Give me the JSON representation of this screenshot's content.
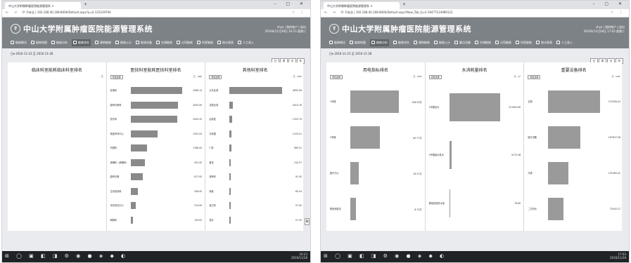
{
  "screens": [
    {
      "tab_title": "中山大学附属肿瘤医院能源管理系 ×",
      "url": "不安全 | 192.168.40.168:8000/Default.aspx?p=0.125239794",
      "app_title": "中山大学附属肿瘤医院能源管理系统",
      "user_line1": "zhyz | 我的帐户 | 退出",
      "user_line2": "2016年11月28日 16:23 星期二",
      "menu": [
        "能耗概况",
        "能耗地图",
        "能耗分析",
        "能耗排名",
        "建筑能耗",
        "能耗公示",
        "能效设备",
        "空调能耗",
        "分项能耗",
        "科室能耗",
        "统计报表",
        "人工录入"
      ],
      "active_menu": 3,
      "date_range": "日▾ 2016-11-23 至 2016-11-28",
      "periods": [
        "日",
        "周",
        "月",
        "年"
      ],
      "panels": [
        {
          "title": "临床科室能耗临床科室排名",
          "col_left": "",
          "col_right": "元",
          "rows": []
        },
        {
          "title": "医技科室能耗医技科室排名",
          "col_left": "项目选择",
          "col_right": "元 · kWh",
          "rows": [
            {
              "label": "影像科",
              "value": "2086.14",
              "bar": 0.96
            },
            {
              "label": "超声诊断科",
              "value": "2005.00",
              "bar": 0.88
            },
            {
              "label": "放疗科",
              "value": "2005.25",
              "bar": 0.86
            },
            {
              "label": "核医学科中心",
              "value": "1392.04",
              "bar": 0.5
            },
            {
              "label": "内镜科",
              "value": "1186.00",
              "bar": 0.3
            },
            {
              "label": "病理科（病理科）",
              "value": "932.00",
              "bar": 0.26
            },
            {
              "label": "超声诊断",
              "value": "817.00",
              "bar": 0.22
            },
            {
              "label": "生化检验科",
              "value": "348.00",
              "bar": 0.14
            },
            {
              "label": "消毒供应中心",
              "value": "314.00",
              "bar": 0.1
            },
            {
              "label": "麻醉科",
              "value": "159.82",
              "bar": 0.05
            }
          ]
        },
        {
          "title": "其他科室排名",
          "col_left": "项目选择",
          "col_right": "元 · kWh",
          "rows": [
            {
              "label": "公共区域",
              "value": "4830.06",
              "bar": 0.98
            },
            {
              "label": "住院区域",
              "value": "4010.76",
              "bar": 0.06
            },
            {
              "label": "后勤处",
              "value": "1303.79",
              "bar": 0.05
            },
            {
              "label": "行政楼",
              "value": "1229.41",
              "bar": 0.04
            },
            {
              "label": "门诊",
              "value": "969.31",
              "bar": 0.03
            },
            {
              "label": "食堂",
              "value": "242.57",
              "bar": 0.02
            },
            {
              "label": "营养科",
              "value": "91.00",
              "bar": 0.0
            },
            {
              "label": "宿舍",
              "value": "65.44",
              "bar": 0.0
            },
            {
              "label": "保卫科",
              "value": "57.00",
              "bar": 0.0
            },
            {
              "label": "党办",
              "value": "57.00",
              "bar": 0.0
            }
          ]
        }
      ],
      "taskbar_time": "16:23",
      "taskbar_date": "2016/11/28"
    },
    {
      "tab_title": "中山大学附属肿瘤医院能源管理系 ×",
      "url": "不安全 | 192.168.40.168:8000/Default.aspx?New_Tab_Q=0.19477124989123",
      "app_title": "中山大学附属肿瘤医院能源管理系统",
      "user_line1": "zhyz | 我的帐户 | 退出",
      "user_line2": "2016年11月28日 17:03 星期二",
      "menu": [
        "能耗概况",
        "能耗地图",
        "能耗分析",
        "能耗排名",
        "建筑能耗",
        "能耗公示",
        "重点设备",
        "空调能耗",
        "分项能耗",
        "科室能耗",
        "统计报表",
        "人工录入"
      ],
      "active_menu": 2,
      "date_range": "日▾ 2016-11-23 至 2016-11-28",
      "periods": [
        "日",
        "周",
        "月",
        "年"
      ],
      "panels": [
        {
          "title": "用电指标排名",
          "col_left": "项目选择",
          "col_right": "元 · kWh",
          "rows": [
            {
              "label": "1号楼",
              "value": "108.90万",
              "bar": 0.9
            },
            {
              "label": "2号楼",
              "value": "60.77万",
              "bar": 0.55
            },
            {
              "label": "医疗中心",
              "value": "18.31万",
              "bar": 0.16
            },
            {
              "label": "配电房能总",
              "value": "8.74万",
              "bar": 0.1
            }
          ]
        },
        {
          "title": "水消耗量排名",
          "col_left": "项目选择",
          "col_right": "元 · m³",
          "rows": [
            {
              "label": "1号楼总水",
              "value": "221081.80",
              "bar": 0.95
            },
            {
              "label": "2号楼副水表水",
              "value": "9173.48",
              "bar": 0.04
            },
            {
              "label": "基础设施总水量",
              "value": "76.80",
              "bar": 0.0
            }
          ]
        },
        {
          "title": "重要设备排名",
          "col_left": "项目选择",
          "col_right": "元 · kWh",
          "rows": [
            {
              "label": "空调",
              "value": "272058.44",
              "bar": 0.96
            },
            {
              "label": "医疗设备",
              "value": "167627.58",
              "bar": 0.6
            },
            {
              "label": "冷源",
              "value": "101083.42",
              "bar": 0.38
            },
            {
              "label": "二次供水",
              "value": "75043.27",
              "bar": 0.28
            }
          ]
        }
      ],
      "taskbar_time": "17:03",
      "taskbar_date": "2016/11/28"
    }
  ],
  "icons": {
    "logo": "hospital-logo",
    "back": "back-arrow-icon",
    "forward": "forward-arrow-icon",
    "reload": "reload-icon",
    "side_collapse": "collapse-icon"
  },
  "colors": {
    "header_bg": "#7d8287",
    "bar": "#8a8a8a",
    "taskbar": "#1f2326"
  }
}
